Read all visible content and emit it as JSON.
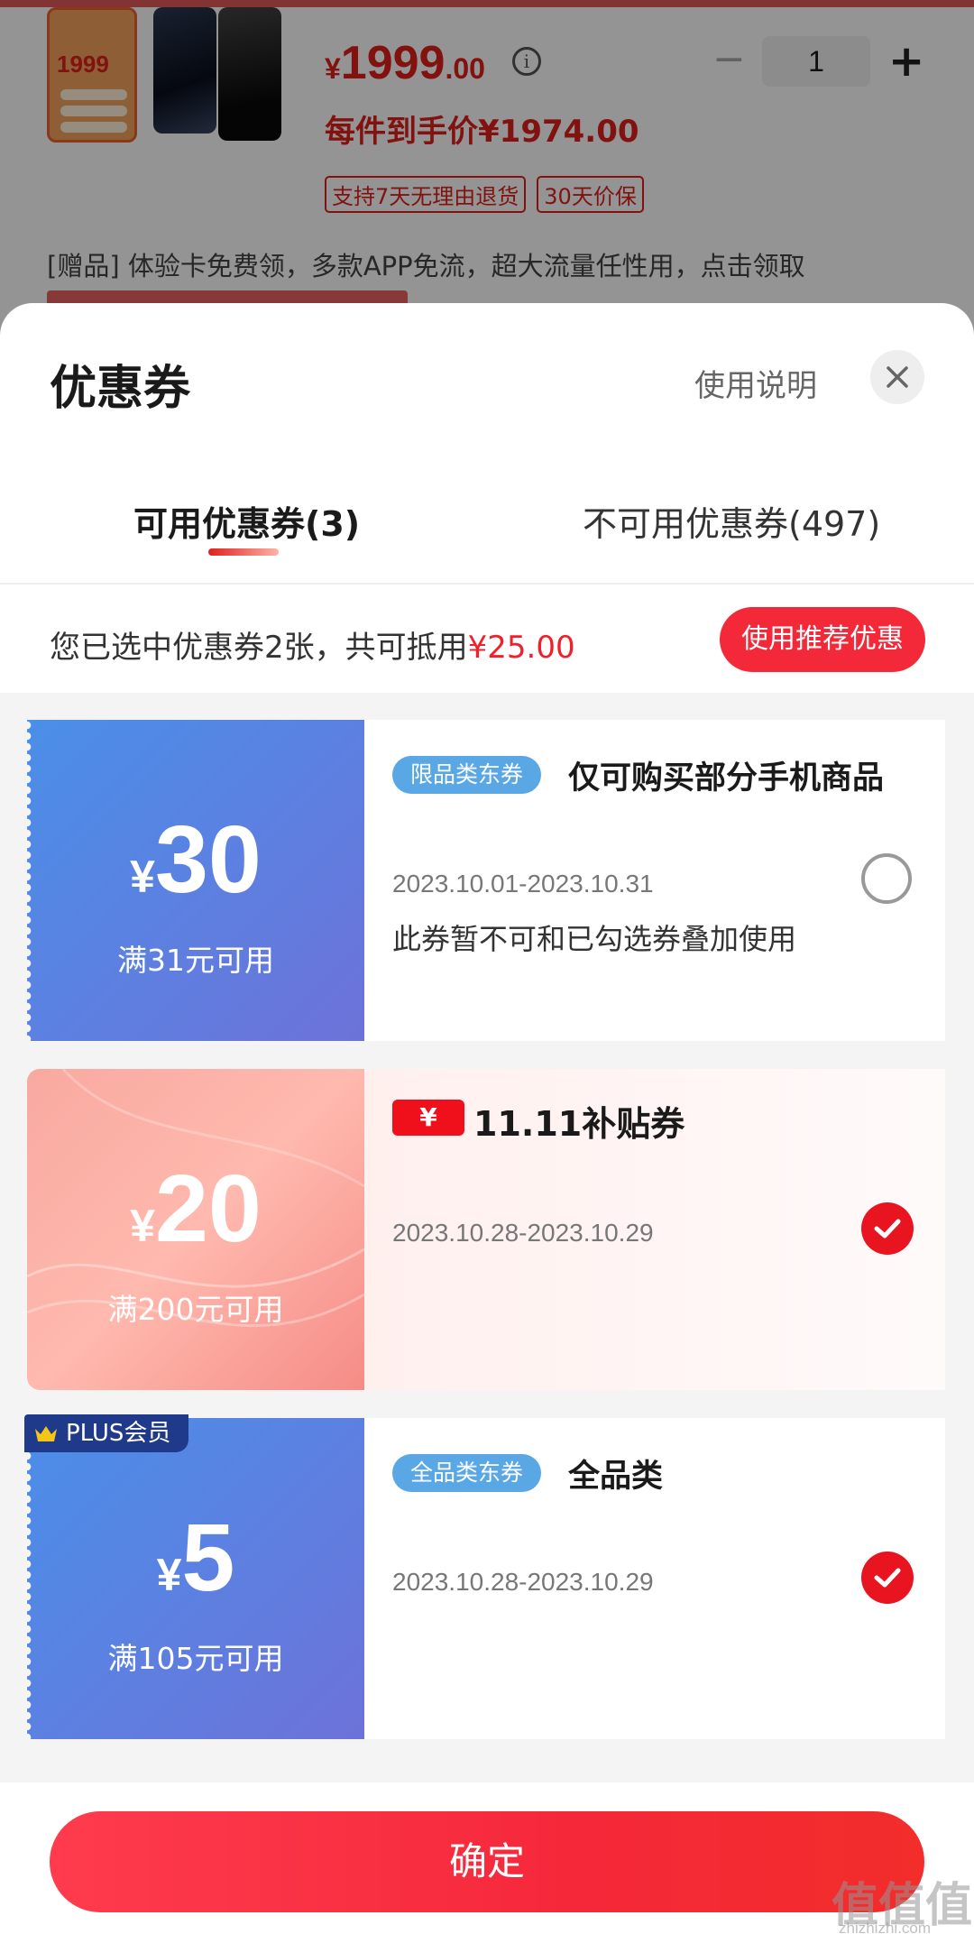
{
  "product": {
    "thumb_price": "1999",
    "currency": "¥",
    "price_int": "1999",
    "price_dec": ".00",
    "quantity": "1",
    "hand_price": "每件到手价¥1974.00",
    "tags": [
      "支持7天无理由退货",
      "30天价保"
    ],
    "gift_text": "[赠品] 体验卡免费领，多款APP免流，超大流量任性用，点击领取"
  },
  "sheet": {
    "title": "优惠券",
    "help_label": "使用说明"
  },
  "tabs": [
    {
      "label": "可用优惠券(3)"
    },
    {
      "label": "不可用优惠券(497)"
    }
  ],
  "summary": {
    "text": "您已选中优惠券2张，共可抵用",
    "amount": "¥25.00",
    "recommend_label": "使用推荐优惠"
  },
  "coupons": [
    {
      "yen": "¥",
      "amount": "30",
      "condition": "满31元可用",
      "badge": "限品类东券",
      "title": "仅可购买部分手机商品",
      "date": "2023.10.01-2023.10.31",
      "note": "此券暂不可和已勾选券叠加使用",
      "selected": false
    },
    {
      "yen": "¥",
      "amount": "20",
      "condition": "满200元可用",
      "logo_mark": "¥",
      "title": "11.11补贴券",
      "date": "2023.10.28-2023.10.29",
      "selected": true
    },
    {
      "yen": "¥",
      "amount": "5",
      "condition": "满105元可用",
      "member_badge": "PLUS会员",
      "badge": "全品类东券",
      "title": "全品类",
      "date": "2023.10.28-2023.10.29",
      "selected": true
    }
  ],
  "confirm_label": "确定",
  "watermark": {
    "logo": "值值值",
    "url": "zhizhizhi.com"
  },
  "colors": {
    "accent_red": "#f3293a",
    "price_red": "#e0201c",
    "coupon_blue": "#5f7ee0",
    "badge_blue": "#5aa7e6",
    "plus_navy": "#1f3a8a"
  }
}
